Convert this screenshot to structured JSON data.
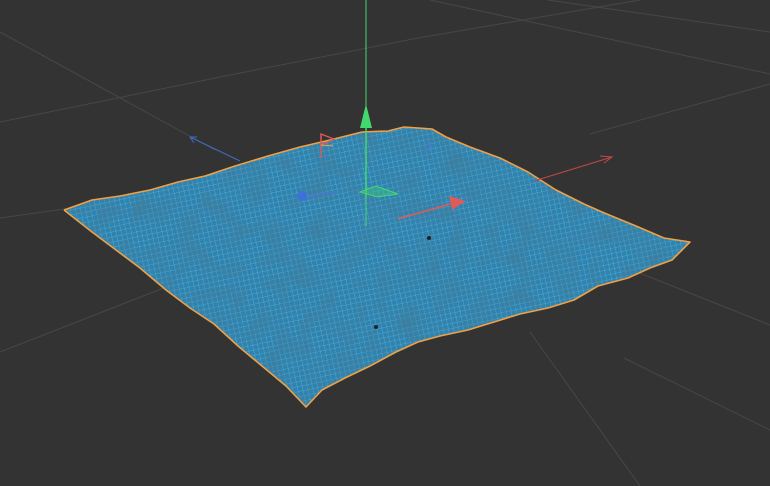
{
  "viewport": {
    "view": "perspective",
    "grid_visible": true,
    "selected_object": "terrain-mesh"
  },
  "colors": {
    "background": "#333333",
    "grid_line": "#474747",
    "mesh_fill": "#2e84b0",
    "mesh_wire": "#bfe6f7",
    "selection_outline": "#f0a045",
    "axis_x": "#e05a5a",
    "axis_y": "#43d86e",
    "axis_z": "#4a78d0"
  },
  "icons": {
    "move_gizmo": "move-gizmo-icon",
    "axis_handles": [
      "x-axis-handle-icon",
      "y-axis-handle-icon",
      "z-axis-handle-icon"
    ]
  }
}
